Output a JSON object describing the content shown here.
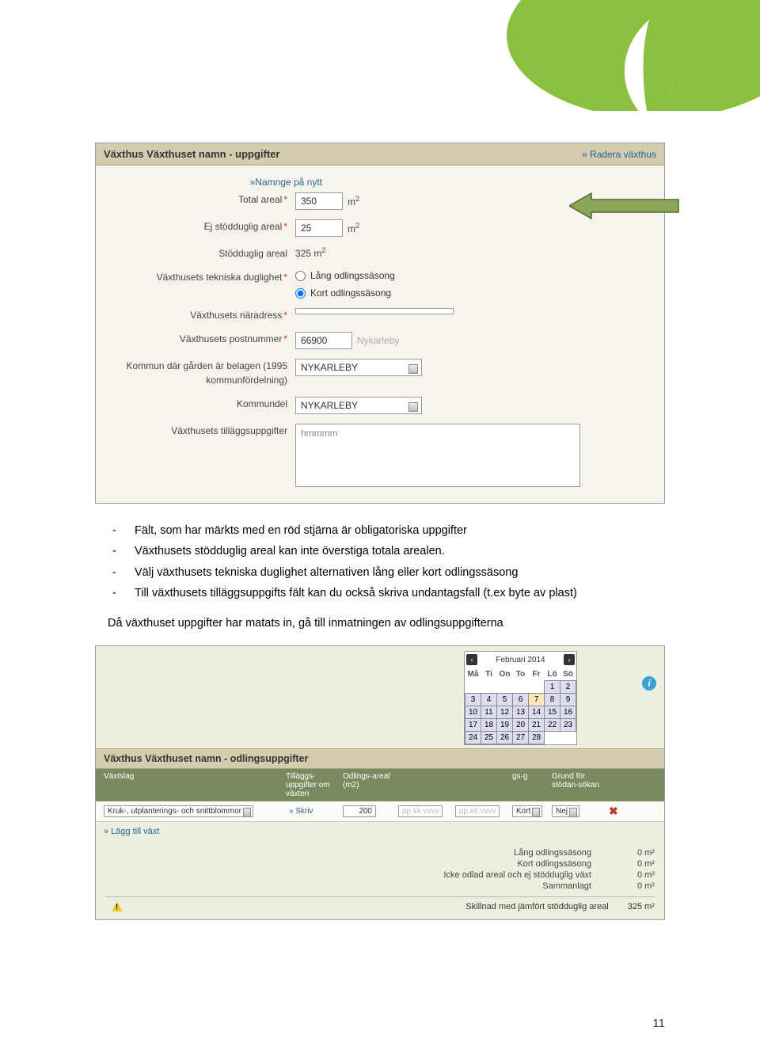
{
  "form1": {
    "title": "Växthus Växthuset namn - uppgifter",
    "deleteLink": "» Radera växthus",
    "renameLink": "»Namnge på nytt",
    "rows": {
      "total_area": {
        "label": "Total areal",
        "value": "350",
        "unit": "m"
      },
      "unsupported_area": {
        "label": "Ej stödduglig areal",
        "value": "25",
        "unit": "m"
      },
      "supported_area": {
        "label": "Stödduglig areal",
        "value": "325 m"
      },
      "technical": {
        "label": "Växthusets tekniska duglighet",
        "opt1": "Lång odlingssäsong",
        "opt2": "Kort odlingssäsong"
      },
      "address": {
        "label": "Växthusets näradress"
      },
      "post": {
        "label": "Växthusets postnummer",
        "value": "66900",
        "city": "Nykarleby"
      },
      "kommun": {
        "label": "Kommun där gården är belagen (1995 kommunfördelning)",
        "value": "NYKARLEBY"
      },
      "kommundel": {
        "label": "Kommundel",
        "value": "NYKARLEBY"
      },
      "extra": {
        "label": "Växthusets tilläggsuppgifter",
        "value": "hmmmm"
      }
    }
  },
  "body": {
    "b1": "Fält, som har märkts med en röd stjärna är obligatoriska uppgifter",
    "b2": "Växthusets stödduglig areal kan inte överstiga totala arealen.",
    "b3": "Välj växthusets tekniska duglighet alternativen lång eller kort odlingssäsong",
    "b4": "Till växthusets tilläggsuppgifts fält kan du också skriva undantagsfall (t.ex byte av plast)",
    "p1": "Då växthuset uppgifter har matats in, gå till inmatningen av odlingsuppgifterna"
  },
  "form2": {
    "cal_month": "Februari 2014",
    "days": [
      "Må",
      "Ti",
      "On",
      "To",
      "Fr",
      "Lö",
      "Sö"
    ],
    "header": "Växthus Växthuset namn - odlingsuppgifter",
    "cols": {
      "c1": "Växtslag",
      "c2": "Tilläggs-uppgifter om växten",
      "c3": "Odlings-areal (m2)",
      "c4": "",
      "c5": "",
      "c6": "gs-g",
      "c7": "Grund för stödan-sökan",
      "c8": ""
    },
    "row": {
      "crop": "Kruk-, utplanterings- och snittblommor",
      "skriv": "» Skriv",
      "area": "200",
      "d1ph": "pp.kk.vvvv",
      "d2ph": "pp.kk.vvvv",
      "season": "Kort",
      "basis": "Nej"
    },
    "add": "» Lägg till växt",
    "sum": {
      "s1l": "Lång odlingssäsong",
      "s1v": "0 m²",
      "s2l": "Kort odlingssäsong",
      "s2v": "0 m²",
      "s3l": "Icke odlad areal och ej stödduglig växt",
      "s3v": "0 m²",
      "s4l": "Sammanlagt",
      "s4v": "0 m²",
      "diffl": "Skillnad med jämfört stödduglig areal",
      "diffv": "325 m²"
    }
  },
  "page": "11"
}
